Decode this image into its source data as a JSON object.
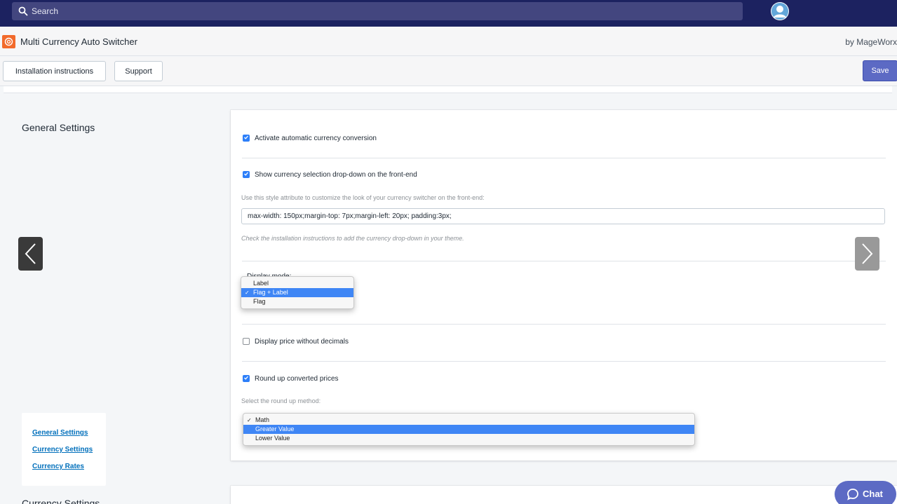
{
  "topbar": {
    "search_placeholder": "Search"
  },
  "app": {
    "title": "Multi Currency Auto Switcher",
    "by": "by MageWorx"
  },
  "actions": {
    "install_label": "Installation instructions",
    "support_label": "Support",
    "save_label": "Save"
  },
  "sections": {
    "general_title": "General Settings",
    "currency_title": "Currency Settings"
  },
  "settings": {
    "auto_conversion": {
      "label": "Activate automatic currency conversion",
      "checked": true
    },
    "show_dropdown": {
      "label": "Show currency selection drop-down on the front-end",
      "checked": true
    },
    "style_help": "Use this style attribute to customize the look of your currency switcher on the front-end:",
    "style_value": "max-width: 150px;margin-top: 7px;margin-left: 20px; padding:3px;",
    "install_help": "Check the installation instructions to add the currency drop-down in your theme.",
    "display_mode_label": "Display mode:",
    "display_mode": {
      "options": [
        "Label",
        "Flag + Label",
        "Flag"
      ],
      "checked": "Flag + Label",
      "highlighted": "Flag + Label"
    },
    "no_decimals": {
      "label": "Display price without decimals",
      "checked": false
    },
    "round_up": {
      "label": "Round up converted prices",
      "checked": true
    },
    "round_method_help": "Select the round up method:",
    "round_method": {
      "options": [
        "Math",
        "Greater Value",
        "Lower Value"
      ],
      "checked": "Math",
      "highlighted": "Greater Value"
    }
  },
  "nav": {
    "links": [
      "General Settings",
      "Currency Settings",
      "Currency Rates"
    ]
  },
  "chat": {
    "label": "Chat"
  },
  "colors": {
    "topbar": "#1c2260",
    "accent": "#5c6ac4",
    "link": "#006fbb",
    "checkbox": "#2d7ff9",
    "dropdown_highlight": "#3f86f5"
  }
}
